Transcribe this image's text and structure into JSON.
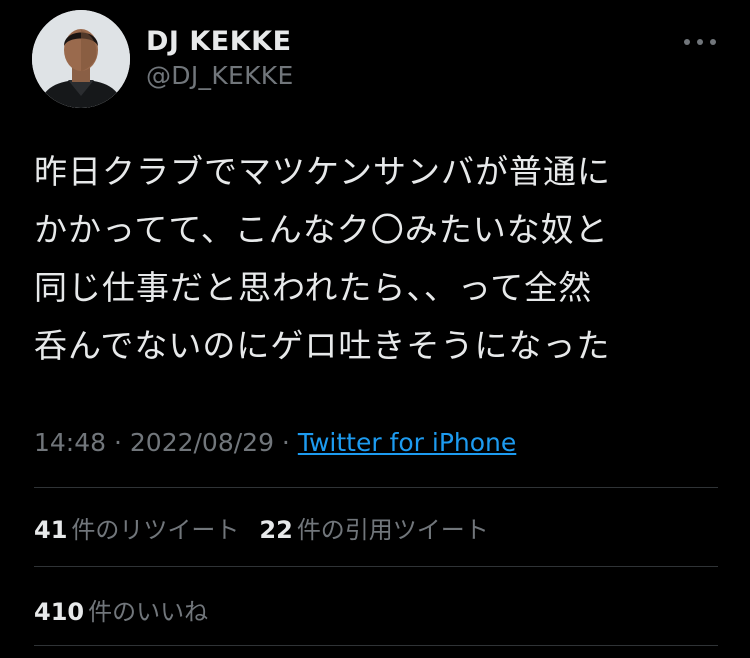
{
  "user": {
    "display_name": "DJ KEKKE",
    "handle": "@DJ_KEKKE"
  },
  "tweet": {
    "lines": [
      "昨日クラブでマツケンサンバが普通に",
      "かかってて、こんなク〇みたいな奴と",
      "同じ仕事だと思われたら、、って全然",
      "呑んでないのにゲロ吐きそうになった"
    ],
    "time": "14:48",
    "separator": " · ",
    "date": "2022/08/29",
    "source": "Twitter for iPhone"
  },
  "stats": {
    "retweets": {
      "count": "41",
      "label": "件のリツイート"
    },
    "quotes": {
      "count": "22",
      "label": "件の引用ツイート"
    },
    "likes": {
      "count": "410",
      "label": "件のいいね"
    }
  },
  "colors": {
    "background": "#000000",
    "text": "#e7e9ea",
    "secondary": "#71767b",
    "link": "#1d9bf0",
    "divider": "#2f3336"
  }
}
